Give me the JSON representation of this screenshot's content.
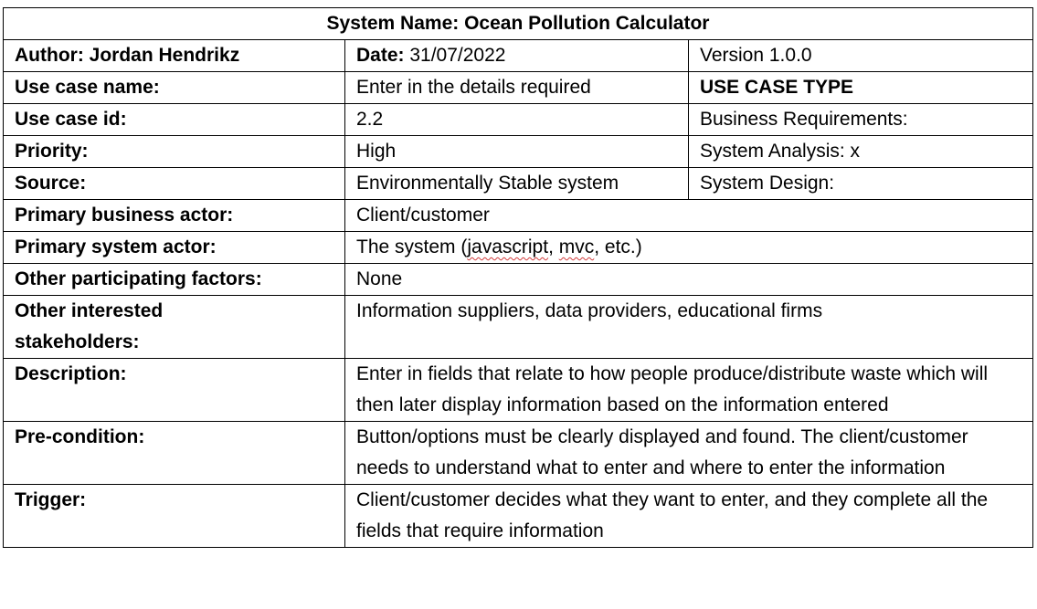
{
  "title": "System Name: Ocean Pollution Calculator",
  "header": {
    "author_label": "Author:",
    "author_value": "Jordan Hendrikz",
    "date_label": "Date:",
    "date_value": "31/07/2022",
    "version": "Version 1.0.0"
  },
  "rows": {
    "use_case_name": {
      "label": "Use case name:",
      "value": "Enter in the details required",
      "side": "USE CASE TYPE"
    },
    "use_case_id": {
      "label": "Use case id:",
      "value": "2.2",
      "side": "Business Requirements:"
    },
    "priority": {
      "label": "Priority:",
      "value": "High",
      "side": "System Analysis: x"
    },
    "source": {
      "label": "Source:",
      "value": "Environmentally Stable system",
      "side": "System Design:"
    },
    "primary_business_actor": {
      "label": "Primary business actor:",
      "value": "Client/customer"
    },
    "primary_system_actor": {
      "label": "Primary system actor:",
      "value_prefix": "The system (",
      "value_word1": "javascript",
      "value_sep": ", ",
      "value_word2": "mvc",
      "value_suffix": ", etc.)"
    },
    "other_participating_factors": {
      "label": "Other participating factors:",
      "value": "None"
    },
    "other_interested_stakeholders": {
      "label": "Other interested stakeholders:",
      "value": "Information suppliers, data providers, educational firms"
    },
    "description": {
      "label": "Description:",
      "value": "Enter in fields that relate to how people produce/distribute waste which will then later display information based on the information entered"
    },
    "pre_condition": {
      "label": "Pre-condition:",
      "value": "Button/options must be clearly displayed and found. The client/customer needs to understand what to enter and where to enter the information"
    },
    "trigger": {
      "label": "Trigger:",
      "value": "Client/customer decides what they want to enter, and they complete all the fields that require information"
    }
  }
}
